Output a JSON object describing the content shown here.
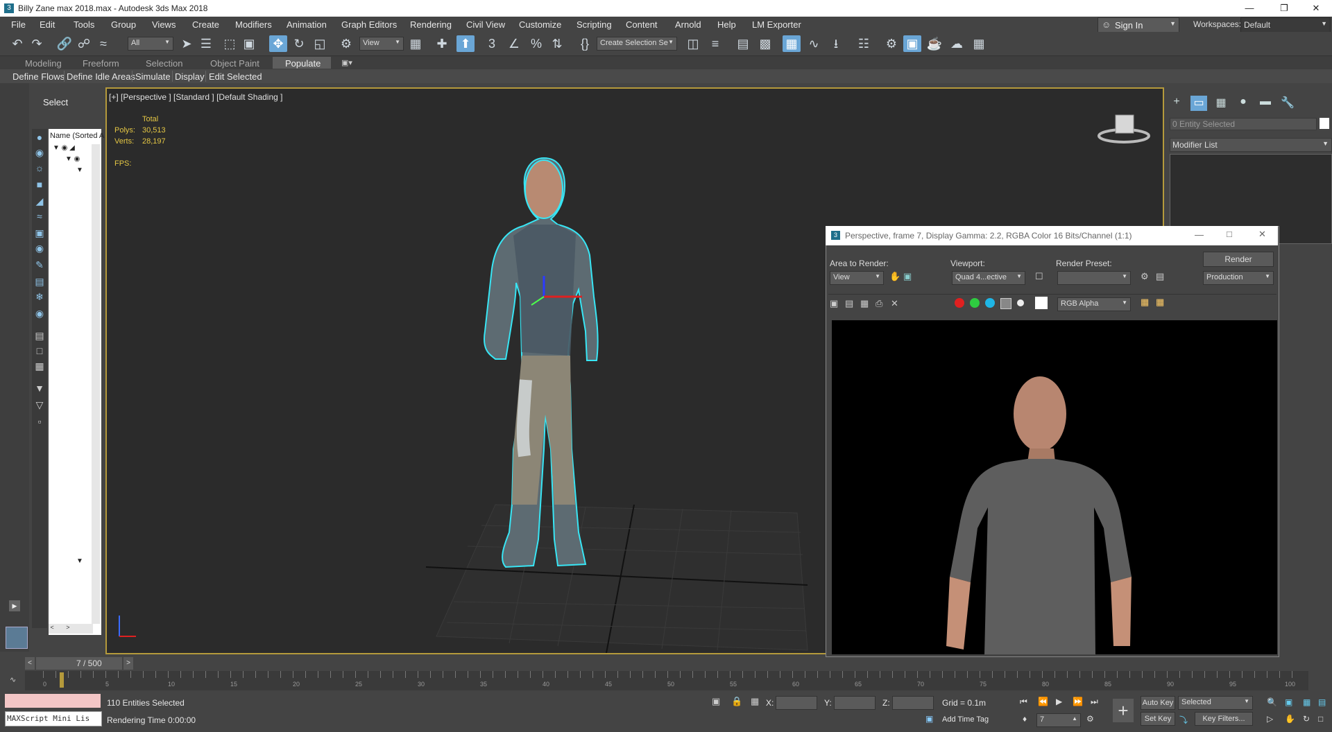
{
  "window": {
    "title": "Billy Zane max 2018.max - Autodesk 3ds Max 2018"
  },
  "menu": [
    "File",
    "Edit",
    "Tools",
    "Group",
    "Views",
    "Create",
    "Modifiers",
    "Animation",
    "Graph Editors",
    "Rendering",
    "Civil View",
    "Customize",
    "Scripting",
    "Content",
    "Arnold",
    "Help",
    "LM Exporter"
  ],
  "account": {
    "sign_in": "Sign In",
    "workspaces_label": "Workspaces:",
    "workspace": "Default"
  },
  "toolbar": {
    "filter": "All",
    "ref_coord": "View",
    "selection_set": "Create Selection Se"
  },
  "ribbon": {
    "tabs": [
      "Modeling",
      "Freeform",
      "Selection",
      "Object Paint"
    ],
    "active": "Populate",
    "sub": [
      "Define Flows",
      "Define Idle Areas",
      "Simulate",
      "Display",
      "Edit Selected"
    ]
  },
  "scene_explorer": {
    "title": "Select",
    "column": "Name (Sorted A"
  },
  "viewport": {
    "label": "[+] [Perspective ] [Standard ] [Default Shading ]",
    "total": "Total",
    "polys_label": "Polys:",
    "polys": "30,513",
    "verts_label": "Verts:",
    "verts": "28,197",
    "fps_label": "FPS:"
  },
  "command_panel": {
    "entity": "0 Entity Selected",
    "modifier_list": "Modifier List"
  },
  "render_window": {
    "title": "Perspective, frame 7, Display Gamma: 2.2, RGBA Color 16 Bits/Channel (1:1)",
    "area_label": "Area to Render:",
    "area": "View",
    "viewport_label": "Viewport:",
    "viewport": "Quad 4...ective",
    "preset_label": "Render Preset:",
    "preset": "",
    "render_btn": "Render",
    "mode": "Production",
    "channel": "RGB Alpha"
  },
  "timeline": {
    "frame": "7 / 500",
    "ticks": [
      "0",
      "5",
      "10",
      "15",
      "20",
      "25",
      "30",
      "35",
      "40",
      "45",
      "50",
      "55",
      "60",
      "65",
      "70",
      "75",
      "80",
      "85",
      "90",
      "95",
      "100"
    ]
  },
  "status": {
    "maxscript": "MAXScript Mini Lis",
    "selected": "110 Entities Selected",
    "render_time": "Rendering Time  0:00:00",
    "x": "X:",
    "y": "Y:",
    "z": "Z:",
    "grid": "Grid = 0.1m",
    "add_time_tag": "Add Time Tag",
    "auto_key": "Auto Key",
    "set_key": "Set Key",
    "key_mode": "Selected",
    "key_filters": "Key Filters...",
    "frame": "7"
  }
}
